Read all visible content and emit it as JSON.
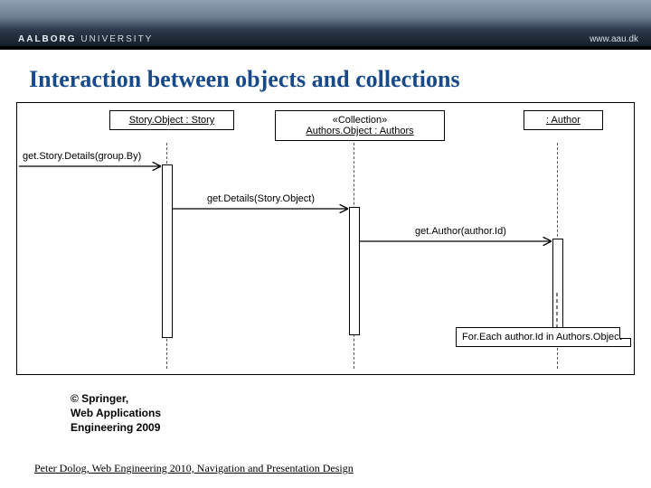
{
  "banner": {
    "logo_primary": "AALBORG",
    "logo_secondary": "UNIVERSITY",
    "url": "www.aau.dk"
  },
  "title": "Interaction between objects and collections",
  "diagram": {
    "objects": {
      "story": {
        "label": "Story.Object : Story"
      },
      "authors": {
        "stereotype": "«Collection»",
        "label": "Authors.Object : Authors"
      },
      "author": {
        "label": ": Author"
      }
    },
    "messages": {
      "m1": "get.Story.Details(group.By)",
      "m2": "get.Details(Story.Object)",
      "m3": "get.Author(author.Id)"
    },
    "note": "For.Each author.Id in Authors.Object"
  },
  "credit": {
    "l1": "© Springer,",
    "l2": "Web Applications",
    "l3": "Engineering 2009"
  },
  "footer": "Peter Dolog, Web Engineering 2010, Navigation and Presentation Design"
}
